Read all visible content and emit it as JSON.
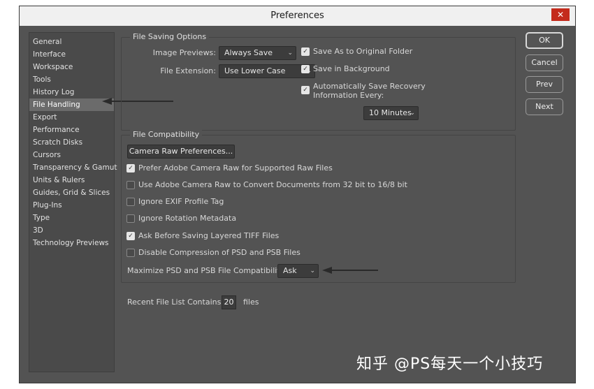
{
  "dialog": {
    "title": "Preferences",
    "close_glyph": "✕"
  },
  "sidebar": {
    "items": [
      {
        "label": "General"
      },
      {
        "label": "Interface"
      },
      {
        "label": "Workspace"
      },
      {
        "label": "Tools"
      },
      {
        "label": "History Log"
      },
      {
        "label": "File Handling",
        "selected": true
      },
      {
        "label": "Export"
      },
      {
        "label": "Performance"
      },
      {
        "label": "Scratch Disks"
      },
      {
        "label": "Cursors"
      },
      {
        "label": "Transparency & Gamut"
      },
      {
        "label": "Units & Rulers"
      },
      {
        "label": "Guides, Grid & Slices"
      },
      {
        "label": "Plug-Ins"
      },
      {
        "label": "Type"
      },
      {
        "label": "3D"
      },
      {
        "label": "Technology Previews"
      }
    ]
  },
  "file_saving": {
    "legend": "File Saving Options",
    "image_previews_label": "Image Previews:",
    "image_previews_value": "Always Save",
    "file_extension_label": "File Extension:",
    "file_extension_value": "Use Lower Case",
    "save_as_original": {
      "label": "Save As to Original Folder",
      "checked": true
    },
    "save_in_background": {
      "label": "Save in Background",
      "checked": true
    },
    "auto_recovery": {
      "label_line1": "Automatically Save Recovery",
      "label_line2": "Information Every:",
      "checked": true
    },
    "recovery_interval_value": "10 Minutes"
  },
  "file_compat": {
    "legend": "File Compatibility",
    "camera_raw_prefs_button": "Camera Raw Preferences...",
    "options": [
      {
        "label": "Prefer Adobe Camera Raw for Supported Raw Files",
        "checked": true
      },
      {
        "label": "Use Adobe Camera Raw to Convert Documents from 32 bit to 16/8 bit",
        "checked": false
      },
      {
        "label": "Ignore EXIF Profile Tag",
        "checked": false
      },
      {
        "label": "Ignore Rotation Metadata",
        "checked": false
      },
      {
        "label": "Ask Before Saving Layered TIFF Files",
        "checked": true
      },
      {
        "label": "Disable Compression of PSD and PSB Files",
        "checked": false
      }
    ],
    "maximize_label": "Maximize PSD and PSB File Compatibility:",
    "maximize_value": "Ask"
  },
  "recent_files": {
    "label": "Recent File List Contains:",
    "value": "20",
    "suffix": "files"
  },
  "buttons": {
    "ok": "OK",
    "cancel": "Cancel",
    "prev": "Prev",
    "next": "Next"
  },
  "icons": {
    "checkmark": "✓",
    "chevron": "⌄"
  },
  "watermark": {
    "text": "知乎 @PS每天一个小技巧"
  },
  "colors": {
    "dialog_bg": "#535353",
    "panel_bg": "#4a4a4a",
    "selected_item_bg": "#6b6b6b",
    "close_button": "#c42b1c",
    "titlebar_bg": "#f0f0f0"
  }
}
